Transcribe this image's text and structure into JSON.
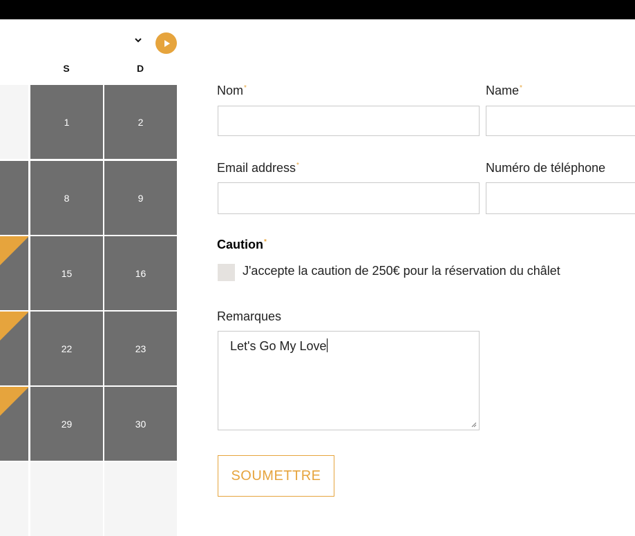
{
  "calendar": {
    "headers": [
      "S",
      "D"
    ],
    "rows": [
      {
        "edge": "light",
        "edge_marked": false,
        "days": [
          "1",
          "2"
        ],
        "style": "dark"
      },
      {
        "edge": "dark",
        "edge_marked": false,
        "days": [
          "8",
          "9"
        ],
        "style": "dark"
      },
      {
        "edge": "dark",
        "edge_marked": true,
        "days": [
          "15",
          "16"
        ],
        "style": "dark"
      },
      {
        "edge": "dark",
        "edge_marked": true,
        "days": [
          "22",
          "23"
        ],
        "style": "dark"
      },
      {
        "edge": "dark",
        "edge_marked": true,
        "days": [
          "29",
          "30"
        ],
        "style": "dark"
      },
      {
        "edge": "light",
        "edge_marked": false,
        "days": [
          "",
          ""
        ],
        "style": "light"
      }
    ],
    "next_icon": "play-icon",
    "dropdown_icon": "chevron-down-icon"
  },
  "form": {
    "nom_label": "Nom",
    "name_label": "Name",
    "email_label": "Email address",
    "phone_label": "Numéro de téléphone",
    "required_mark": "*",
    "nom_value": "",
    "name_value": "",
    "email_value": "",
    "phone_value": "",
    "caution_title": "Caution",
    "caution_checkbox_label": "J'accepte la caution de 250€ pour la réservation du châlet",
    "caution_checked": false,
    "remarks_label": "Remarques",
    "remarks_value": "Let's Go My Love",
    "submit_label": "SOUMETTRE"
  },
  "colors": {
    "accent": "#e6a43d",
    "booked_day": "#6e6e6e",
    "empty_day": "#f5f5f5",
    "topbar": "#000000"
  }
}
